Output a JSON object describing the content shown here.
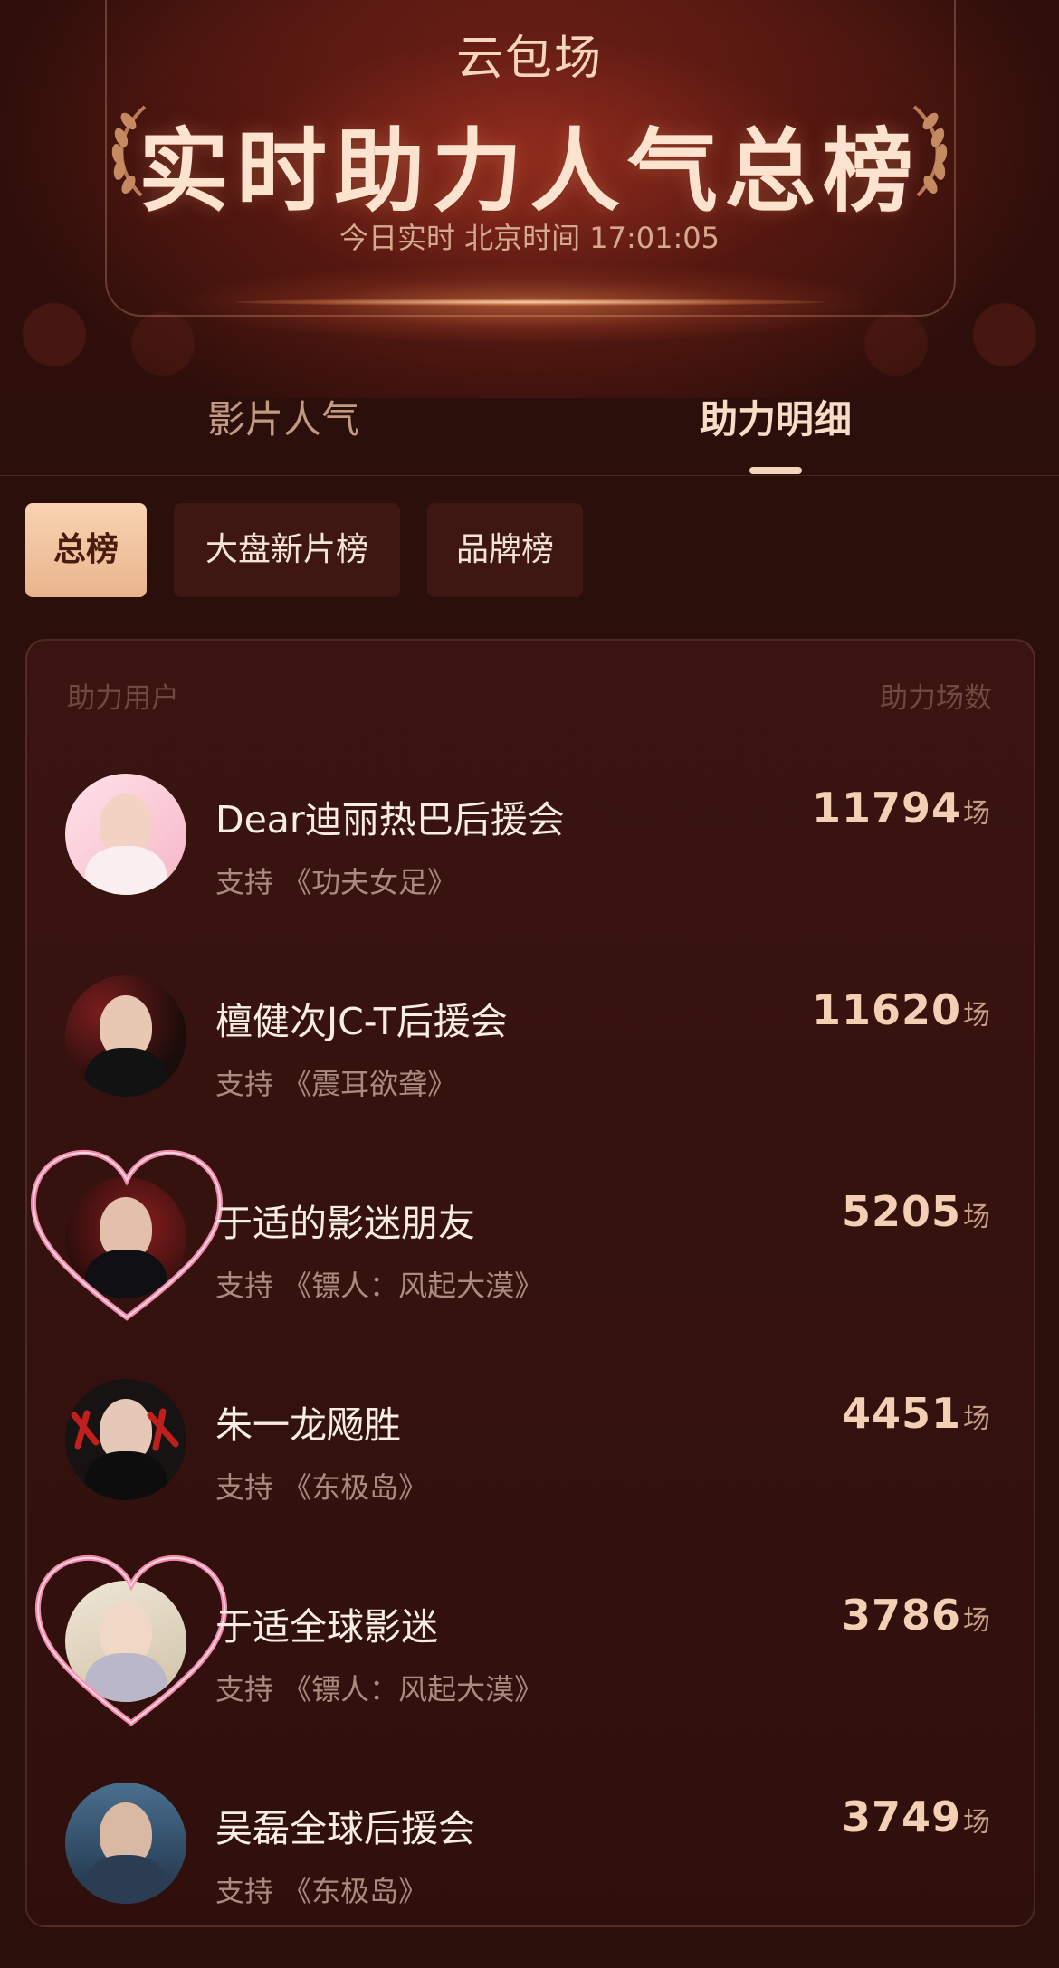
{
  "header": {
    "subtitle": "云包场",
    "title": "实时助力人气总榜",
    "time": "今日实时 北京时间 17:01:05",
    "accent": "#fbe3cf"
  },
  "tabs": [
    {
      "label": "影片人气"
    },
    {
      "label": "助力明细"
    }
  ],
  "chips": [
    {
      "label": "总榜"
    },
    {
      "label": "大盘新片榜"
    },
    {
      "label": "品牌榜"
    }
  ],
  "list": {
    "col_left": "助力用户",
    "col_right": "助力场数",
    "unit": "场",
    "rows": [
      {
        "name": "Dear迪丽热巴后援会",
        "support": "支持 《功夫女足》",
        "count": "11794",
        "unit": "场"
      },
      {
        "name": "檀健次JC-T后援会",
        "support": "支持 《震耳欲聋》",
        "count": "11620",
        "unit": "场"
      },
      {
        "name": "于适的影迷朋友",
        "support": "支持 《镖人：风起大漠》",
        "count": "5205",
        "unit": "场"
      },
      {
        "name": "朱一龙飏胜",
        "support": "支持 《东极岛》",
        "count": "4451",
        "unit": "场"
      },
      {
        "name": "于适全球影迷",
        "support": "支持 《镖人：风起大漠》",
        "count": "3786",
        "unit": "场"
      },
      {
        "name": "吴磊全球后援会",
        "support": "支持 《东极岛》",
        "count": "3749",
        "unit": "场"
      }
    ]
  }
}
